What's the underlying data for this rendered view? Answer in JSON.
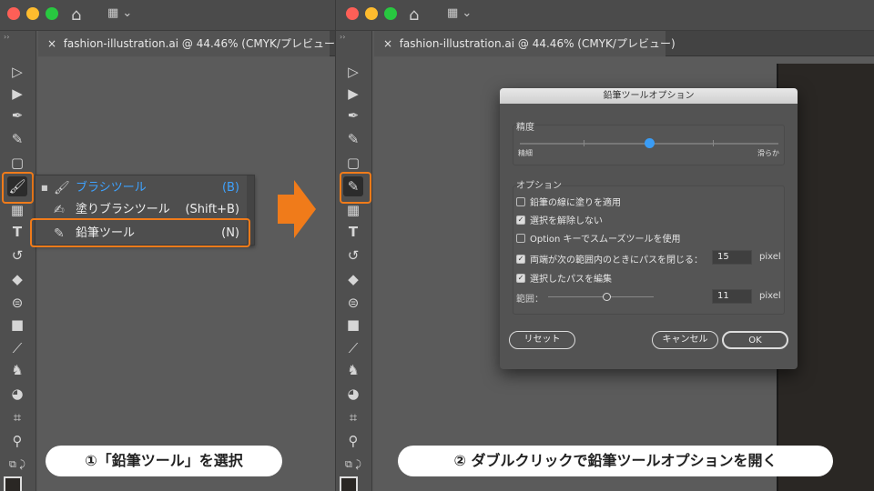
{
  "window": {
    "tab_title": "fashion-illustration.ai @ 44.46% (CMYK/プレビュー)",
    "close_glyph": "×",
    "collapse_glyph": "››"
  },
  "colors": {
    "accent": "#f07b1a",
    "selected_text": "#3ea2ff",
    "slider_knob": "#3a9cf5"
  },
  "flyout": {
    "items": [
      {
        "label": "ブラシツール",
        "shortcut": "(B)",
        "icon": "paintbrush-icon",
        "selected": true
      },
      {
        "label": "塗りブラシツール",
        "shortcut": "(Shift+B)",
        "icon": "blob-brush-icon",
        "selected": false
      },
      {
        "label": "鉛筆ツール",
        "shortcut": "(N)",
        "icon": "pencil-icon",
        "selected": false
      }
    ]
  },
  "dialog": {
    "title": "鉛筆ツールオプション",
    "precision": {
      "label": "精度",
      "min_label": "精細",
      "max_label": "滑らか",
      "value_fraction": 0.5
    },
    "options": {
      "label": "オプション",
      "checkboxes": [
        {
          "label": "鉛筆の線に塗りを適用",
          "checked": false
        },
        {
          "label": "選択を解除しない",
          "checked": true
        },
        {
          "label": "Option キーでスムーズツールを使用",
          "checked": false
        },
        {
          "label": "両端が次の範囲内のときにパスを閉じる：",
          "checked": true,
          "value": "15",
          "unit": "pixel"
        },
        {
          "label": "選択したパスを編集",
          "checked": true
        }
      ],
      "range": {
        "label": "範囲：",
        "value": "11",
        "unit": "pixel",
        "value_fraction": 0.55
      }
    },
    "buttons": {
      "reset": "リセット",
      "cancel": "キャンセル",
      "ok": "OK"
    }
  },
  "captions": {
    "step1": "①「鉛筆ツール」を選択",
    "step2": "② ダブルクリックで鉛筆ツールオプションを開く"
  }
}
